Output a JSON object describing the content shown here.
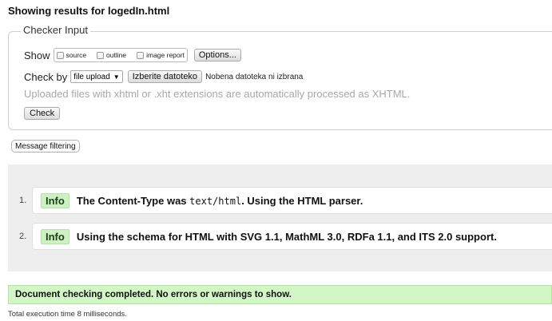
{
  "header": {
    "title": "Showing results for logedIn.html"
  },
  "checker_input": {
    "legend": "Checker Input",
    "show_label": "Show",
    "show_options": [
      {
        "label": "source"
      },
      {
        "label": "outline"
      },
      {
        "label": "image report"
      }
    ],
    "options_button": "Options...",
    "check_by_label": "Check by",
    "check_by_select": "file upload",
    "choose_file_button": "Izberite datoteko",
    "file_status": "Nobena datoteka ni izbrana",
    "hint": "Uploaded files with xhtml or .xht extensions are automatically processed as XHTML.",
    "check_button": "Check"
  },
  "message_filtering_button": "Message filtering",
  "results": [
    {
      "number": "1.",
      "type": "Info",
      "text_before": "The Content-Type was ",
      "code": "text/html",
      "text_after": ". Using the HTML parser."
    },
    {
      "number": "2.",
      "type": "Info",
      "text": "Using the schema for HTML with SVG 1.1, MathML 3.0, RDFa 1.1, and ITS 2.0 support."
    }
  ],
  "summary": "Document checking completed. No errors or warnings to show.",
  "execution_time": "Total execution time 8 milliseconds.",
  "colors": {
    "info_badge": "#cdf0c4",
    "success_bar": "#d3f6c6",
    "results_bg": "#eeeeee"
  }
}
